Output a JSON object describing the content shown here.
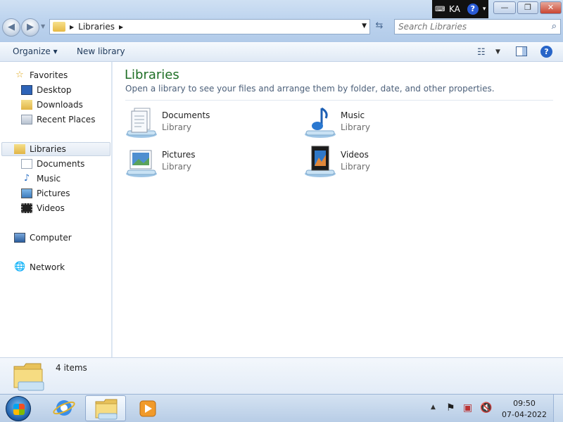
{
  "window": {
    "address": {
      "crumb": "Libraries"
    },
    "search": {
      "placeholder": "Search Libraries"
    },
    "langbar": {
      "language": "KA",
      "help": "?"
    },
    "controls": {
      "minimize": "—",
      "maximize": "❐",
      "close": "✕"
    }
  },
  "toolbar": {
    "organize_label": "Organize ▾",
    "new_library_label": "New library",
    "view_icon": "view-options-icon",
    "help": "?"
  },
  "navpane": {
    "favorites_label": "Favorites",
    "favorites": [
      {
        "label": "Desktop",
        "icon": "desktop-icon"
      },
      {
        "label": "Downloads",
        "icon": "downloads-icon"
      },
      {
        "label": "Recent Places",
        "icon": "recent-places-icon"
      }
    ],
    "libraries_label": "Libraries",
    "libraries": [
      {
        "label": "Documents",
        "icon": "documents-icon"
      },
      {
        "label": "Music",
        "icon": "music-icon"
      },
      {
        "label": "Pictures",
        "icon": "pictures-icon"
      },
      {
        "label": "Videos",
        "icon": "videos-icon"
      }
    ],
    "computer_label": "Computer",
    "network_label": "Network"
  },
  "content": {
    "title": "Libraries",
    "subtitle": "Open a library to see your files and arrange them by folder, date, and other properties.",
    "items": [
      {
        "name": "Documents",
        "type": "Library",
        "icon": "documents-library-icon"
      },
      {
        "name": "Music",
        "type": "Library",
        "icon": "music-library-icon"
      },
      {
        "name": "Pictures",
        "type": "Library",
        "icon": "pictures-library-icon"
      },
      {
        "name": "Videos",
        "type": "Library",
        "icon": "videos-library-icon"
      }
    ]
  },
  "details": {
    "count": "4 items"
  },
  "taskbar": {
    "time": "09:50",
    "date": "07-04-2022",
    "apps": [
      "internet-explorer-icon",
      "windows-explorer-icon",
      "media-player-icon"
    ]
  },
  "colors": {
    "title_green": "#1f6f26",
    "accent_blue": "#2865c8",
    "close_red": "#c94531"
  }
}
